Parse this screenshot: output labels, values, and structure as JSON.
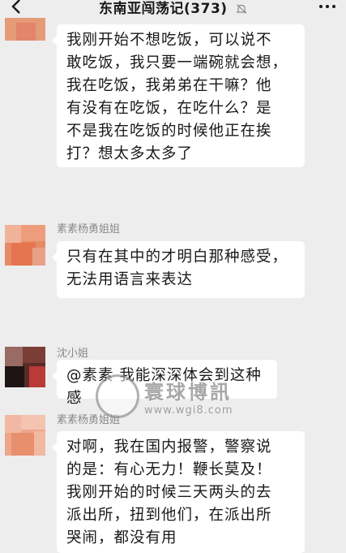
{
  "header": {
    "title": "东南亚闯荡记(373)",
    "back_icon": "chevron-left-icon",
    "mute_icon": "bell-off-icon",
    "more_icon": "more-dots-icon"
  },
  "messages": [
    {
      "sender": "",
      "text": "我刚开始不想吃饭，可以说不\n敢吃饭，我只要一端碗就会想，\n我在吃饭，我弟弟在干嘛？他\n有没有在吃饭，在吃什么？是\n不是我在吃饭的时候他正在挨\n打？想太多太多了"
    },
    {
      "sender": "素素杨勇姐姐",
      "text": "只有在其中的才明白那种感受，\n无法用语言来表达"
    },
    {
      "sender": "沈小姐",
      "text": "@素素 我能深深体会到这种感"
    },
    {
      "sender": "素素杨勇姐姐",
      "text": "对啊，我在国内报警，警察说\n的是：有心无力！鞭长莫及！\n我刚开始的时候三天两头的去\n派出所，扭到他们，在派出所\n哭闹，都没有用"
    }
  ],
  "watermark": {
    "main": "寰球博訊",
    "url": "www.wgi8.com"
  }
}
